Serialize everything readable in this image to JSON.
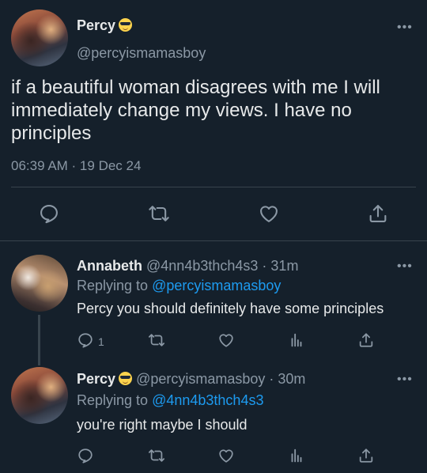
{
  "main_tweet": {
    "author_name": "Percy",
    "author_handle": "@percyismamasboy",
    "text": "if a beautiful woman disagrees with me I will immediately change my views. I have no principles",
    "timestamp": "06:39 AM · 19 Dec 24",
    "more_label": "•••",
    "actions": [
      "reply-icon",
      "retweet-icon",
      "like-icon",
      "share-icon"
    ]
  },
  "replies": [
    {
      "author_name": "Annabeth",
      "author_handle": "@4nn4b3thch4s3",
      "time_ago": "· 31m",
      "replying_prefix": "Replying to",
      "replying_to": "@percyismamasboy",
      "text": "Percy you should definitely have some principles",
      "reply_count": "1",
      "more_label": "•••"
    },
    {
      "author_name": "Percy",
      "author_handle": "@percyismamasboy",
      "time_ago": "· 30m",
      "replying_prefix": "Replying to",
      "replying_to": "@4nn4b3thch4s3",
      "text": "you're right maybe I should",
      "reply_count": "",
      "more_label": "•••"
    }
  ],
  "colors": {
    "background": "#15202b",
    "text": "#e7e9ea",
    "muted": "#8b98a5",
    "link": "#1d9bf0",
    "divider": "#38444d"
  }
}
